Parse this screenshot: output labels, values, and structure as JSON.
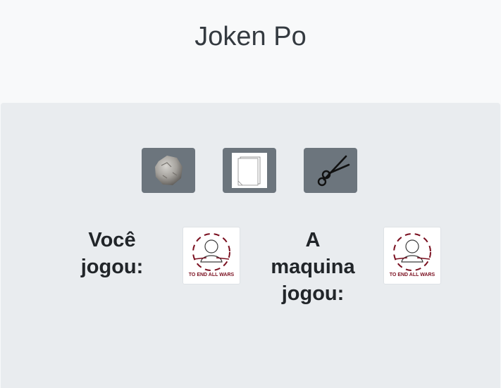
{
  "app": {
    "title": "Joken Po"
  },
  "choices": [
    {
      "name": "rock",
      "icon": "rock-icon"
    },
    {
      "name": "paper",
      "icon": "paper-icon"
    },
    {
      "name": "scissors",
      "icon": "scissors-icon"
    }
  ],
  "player": {
    "label": "Você jogou:"
  },
  "machine": {
    "label": "A maquina jogou:"
  },
  "result_image": {
    "caption": "TO END ALL WARS"
  },
  "colors": {
    "header_bg": "#f8f9fa",
    "card_bg": "#e9ecef",
    "button_bg": "#6c757d",
    "caption_red": "#7a0f1f"
  }
}
